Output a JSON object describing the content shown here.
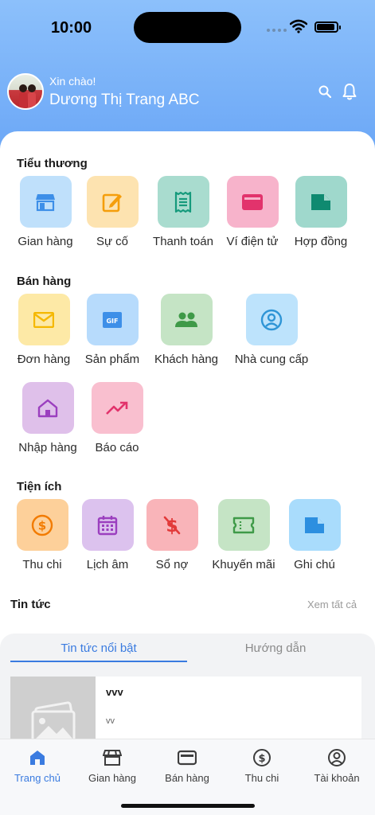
{
  "status": {
    "time": "10:00"
  },
  "header": {
    "greeting": "Xin chào!",
    "user_name": "Dương Thị Trang ABC"
  },
  "sections": {
    "tieu_thuong": {
      "title": "Tiểu thương",
      "items": [
        {
          "label": "Gian hàng",
          "icon": "store-icon",
          "color": "#bfe0fb",
          "icon_color": "#3d8fe8"
        },
        {
          "label": "Sự cố",
          "icon": "edit-icon",
          "color": "#fde3b0",
          "icon_color": "#f59e0b"
        },
        {
          "label": "Thanh toán",
          "icon": "receipt-icon",
          "color": "#a9dccf",
          "icon_color": "#159a7c"
        },
        {
          "label": "Ví điện tử",
          "icon": "wallet-icon",
          "color": "#f7b3cb",
          "icon_color": "#e2336c"
        },
        {
          "label": "Hợp đồng",
          "icon": "document-icon",
          "color": "#9fd8cc",
          "icon_color": "#0f8a70"
        }
      ]
    },
    "ban_hang": {
      "title": "Bán hàng",
      "items": [
        {
          "label": "Đơn hàng",
          "icon": "mail-icon",
          "color": "#fde9a6",
          "icon_color": "#f5b800"
        },
        {
          "label": "Sản phẩm",
          "icon": "gif-icon",
          "color": "#b7dbfc",
          "icon_color": "#3d8fe8"
        },
        {
          "label": "Khách hàng",
          "icon": "people-icon",
          "color": "#c5e4c5",
          "icon_color": "#3f9a48"
        },
        {
          "label": "Nhà cung cấp",
          "icon": "user-circle-icon",
          "color": "#bde3fc",
          "icon_color": "#2f95d6"
        },
        {
          "label": "Nhập hàng",
          "icon": "home-icon",
          "color": "#dfc0ea",
          "icon_color": "#9b3fbf"
        },
        {
          "label": "Báo cáo",
          "icon": "trending-up-icon",
          "color": "#f9bfcf",
          "icon_color": "#e2336c"
        }
      ]
    },
    "tien_ich": {
      "title": "Tiện ích",
      "items": [
        {
          "label": "Thu chi",
          "icon": "dollar-circle-icon",
          "color": "#fdd09a",
          "icon_color": "#f27b00"
        },
        {
          "label": "Lịch âm",
          "icon": "calendar-icon",
          "color": "#dcc2ee",
          "icon_color": "#9b3fbf"
        },
        {
          "label": "Sổ nợ",
          "icon": "money-off-icon",
          "color": "#f9b4b9",
          "icon_color": "#e23a3a"
        },
        {
          "label": "Khuyến mãi",
          "icon": "ticket-icon",
          "color": "#c5e4c5",
          "icon_color": "#3f9a48"
        },
        {
          "label": "Ghi chú",
          "icon": "note-icon",
          "color": "#a9dcfc",
          "icon_color": "#2c8fe0"
        }
      ]
    }
  },
  "news": {
    "title": "Tin tức",
    "see_all": "Xem tất cả",
    "tabs": [
      {
        "label": "Tin tức nổi bật",
        "active": true
      },
      {
        "label": "Hướng dẫn",
        "active": false
      }
    ],
    "items": [
      {
        "title": "vvv",
        "subtitle": "vv"
      }
    ]
  },
  "bottom_nav": [
    {
      "label": "Trang chủ",
      "icon": "home-icon",
      "active": true
    },
    {
      "label": "Gian hàng",
      "icon": "store-icon",
      "active": false
    },
    {
      "label": "Bán hàng",
      "icon": "wallet-icon",
      "active": false
    },
    {
      "label": "Thu chi",
      "icon": "dollar-circle-icon",
      "active": false
    },
    {
      "label": "Tài khoản",
      "icon": "account-icon",
      "active": false
    }
  ],
  "colors": {
    "accent": "#3a7be0",
    "header_top": "#8cc0fb",
    "header_bottom": "#6aa6f6"
  }
}
